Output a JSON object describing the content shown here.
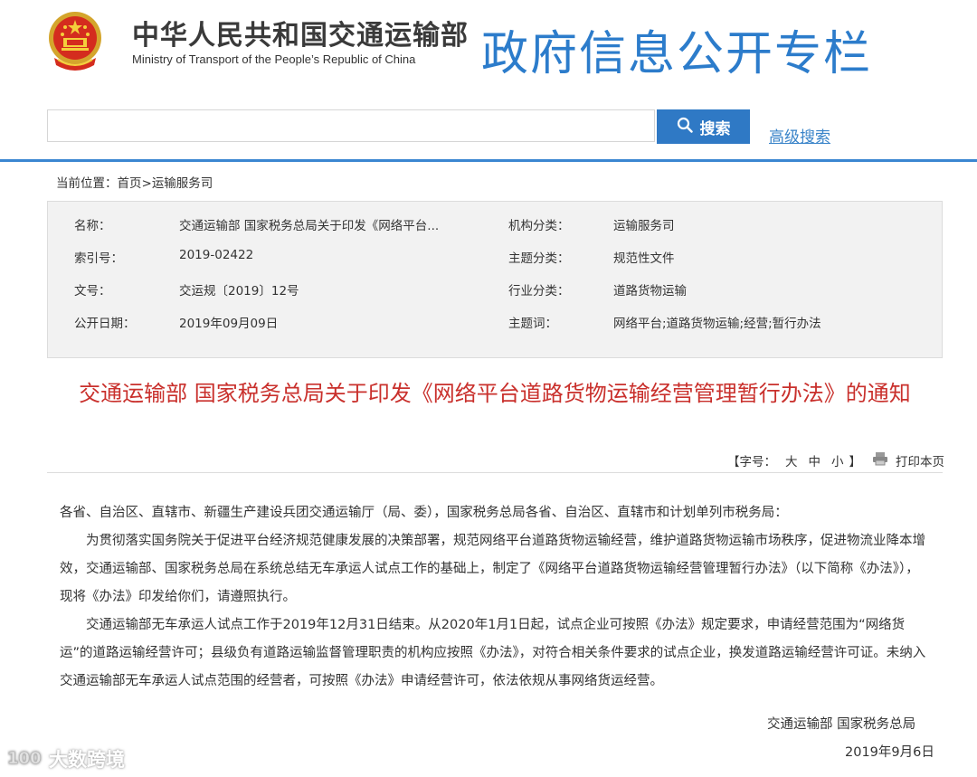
{
  "header": {
    "ministry_cn": "中华人民共和国交通运输部",
    "ministry_en": "Ministry of Transport of the People’s Republic of China",
    "column_title": "政府信息公开专栏"
  },
  "search": {
    "placeholder": "",
    "button_label": "搜索",
    "advanced_label": "高级搜索"
  },
  "breadcrumb": {
    "prefix": "当前位置：",
    "home": "首页",
    "sep": ">",
    "current": "运输服务司"
  },
  "info": {
    "rows": [
      {
        "label": "名称：",
        "value": "交通运输部 国家税务总局关于印发《网络平台...",
        "label2": "机构分类：",
        "value2": "运输服务司"
      },
      {
        "label": "索引号：",
        "value": "2019-02422",
        "label2": "主题分类：",
        "value2": "规范性文件"
      },
      {
        "label": "文号：",
        "value": "交运规〔2019〕12号",
        "label2": "行业分类：",
        "value2": "道路货物运输"
      },
      {
        "label": "公开日期：",
        "value": "2019年09月09日",
        "label2": "主题词：",
        "value2": "网络平台;道路货物运输;经营;暂行办法"
      }
    ]
  },
  "document": {
    "title": "交通运输部 国家税务总局关于印发《网络平台道路货物运输经营管理暂行办法》的通知",
    "font_size_label": "【字号：",
    "size_large": "大",
    "size_medium": "中",
    "size_small": "小",
    "font_size_end": "】",
    "print_label": "打印本页",
    "paragraphs": [
      "各省、自治区、直辖市、新疆生产建设兵团交通运输厅（局、委），国家税务总局各省、自治区、直辖市和计划单列市税务局：",
      "为贯彻落实国务院关于促进平台经济规范健康发展的决策部署，规范网络平台道路货物运输经营，维护道路货物运输市场秩序，促进物流业降本增效，交通运输部、国家税务总局在系统总结无车承运人试点工作的基础上，制定了《网络平台道路货物运输经营管理暂行办法》（以下简称《办法》），现将《办法》印发给你们，请遵照执行。",
      "交通运输部无车承运人试点工作于2019年12月31日结束。从2020年1月1日起，试点企业可按照《办法》规定要求，申请经营范围为“网络货运”的道路运输经营许可；县级负有道路运输监督管理职责的机构应按照《办法》，对符合相关条件要求的试点企业，换发道路运输经营许可证。未纳入交通运输部无车承运人试点范围的经营者，可按照《办法》申请经营许可，依法依规从事网络货运经营。"
    ],
    "signature_org": "交通运输部 国家税务总局",
    "signature_date": "2019年9月6日"
  },
  "watermark": "大数跨境",
  "colors": {
    "brand_blue": "#2c7ccb",
    "title_red": "#c9302c",
    "search_button": "#2f79c5"
  }
}
